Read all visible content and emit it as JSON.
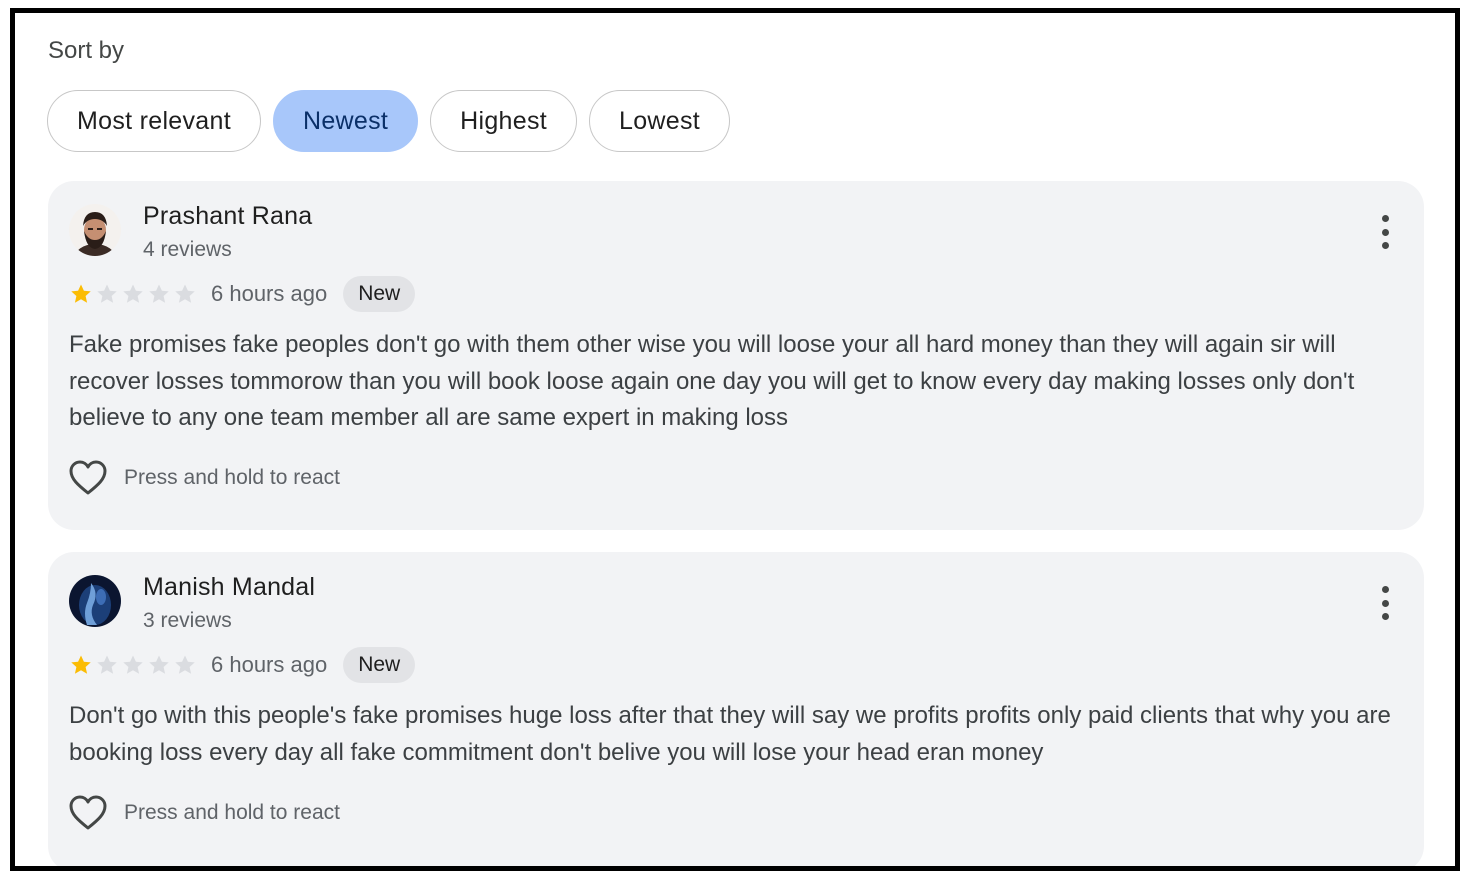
{
  "sort": {
    "label": "Sort by",
    "options": [
      {
        "label": "Most relevant",
        "selected": false
      },
      {
        "label": "Newest",
        "selected": true
      },
      {
        "label": "Highest",
        "selected": false
      },
      {
        "label": "Lowest",
        "selected": false
      }
    ]
  },
  "reviews": [
    {
      "author": "Prashant Rana",
      "author_reviews": "4 reviews",
      "rating": 1,
      "rating_max": 5,
      "time": "6 hours ago",
      "badge": "New",
      "text": "Fake promises fake peoples don't go with them other wise you will loose your all hard money than they will again sir will recover losses tommorow than you will book loose again one day you will get to know every day making losses only don't believe to any one team member all are same expert in making loss",
      "react_label": "Press and hold to react",
      "avatar_icon": "person-photo-avatar"
    },
    {
      "author": "Manish Mandal",
      "author_reviews": "3 reviews",
      "rating": 1,
      "rating_max": 5,
      "time": "6 hours ago",
      "badge": "New",
      "text": "Don't go with this people's fake promises huge loss after that they will say we profits profits only paid clients that why you are booking loss every day all fake commitment don't belive you will lose your head eran money",
      "react_label": "Press and hold to react",
      "avatar_icon": "dark-blue-photo-avatar"
    }
  ],
  "colors": {
    "chip_selected_bg": "#a8c7fa",
    "star_filled": "#fbbc04",
    "star_empty": "#dadce0",
    "card_bg": "#f2f3f5"
  }
}
